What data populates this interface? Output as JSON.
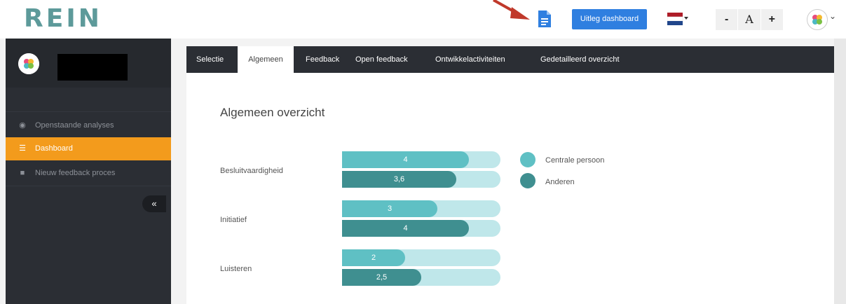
{
  "app": {
    "logo": "REIN"
  },
  "toolbar": {
    "uitleg_label": "Uitleg dashboard",
    "font_minus": "-",
    "font_a": "A",
    "font_plus": "+",
    "avatar_caret": "⌄"
  },
  "sidebar": {
    "items": [
      {
        "label": "Openstaande analyses",
        "icon": "dashboard-gauge-icon",
        "active": false
      },
      {
        "label": "Dashboard",
        "icon": "dashboard-icon",
        "active": true
      },
      {
        "label": "Nieuw feedback proces",
        "icon": "comment-icon",
        "active": false
      }
    ],
    "collapse_label": "«"
  },
  "tabs": [
    {
      "label": "Selectie",
      "active": false
    },
    {
      "label": "Algemeen",
      "active": true
    },
    {
      "label": "Feedback",
      "active": false
    },
    {
      "label": "Open feedback",
      "active": false
    },
    {
      "label": "Ontwikkelactiviteiten",
      "active": false
    },
    {
      "label": "Gedetailleerd overzicht",
      "active": false
    }
  ],
  "panel": {
    "title": "Algemeen overzicht"
  },
  "chart_data": {
    "type": "bar",
    "orientation": "horizontal",
    "categories": [
      "Besluitvaardigheid",
      "Initiatief",
      "Luisteren"
    ],
    "series": [
      {
        "name": "Centrale persoon",
        "values": [
          4,
          3,
          2
        ],
        "labels": [
          "4",
          "3",
          "2"
        ],
        "color": "#5fc0c4"
      },
      {
        "name": "Anderen",
        "values": [
          3.6,
          4,
          2.5
        ],
        "labels": [
          "3,6",
          "4",
          "2,5"
        ],
        "color": "#3f8f90"
      }
    ],
    "xlim": [
      0,
      5
    ],
    "track_color": "#bfe7ea",
    "legend": "right"
  },
  "colors": {
    "accent": "#f39b1c",
    "primary_button": "#2f7fe0",
    "sidebar_bg": "#2b2e34",
    "logo": "#5d9a9a"
  }
}
